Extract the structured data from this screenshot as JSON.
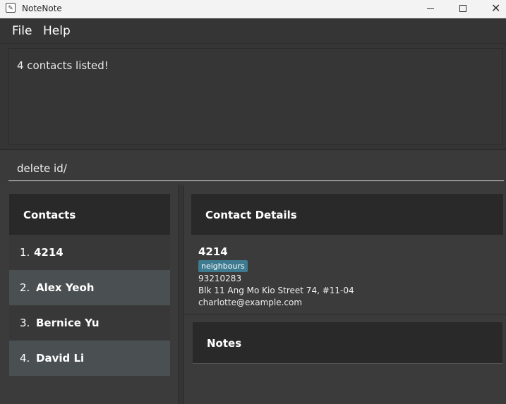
{
  "window": {
    "title": "NoteNote",
    "icons": {
      "app": "notepad-icon",
      "minimize": "minimize-icon",
      "maximize": "maximize-icon",
      "close": "close-icon"
    }
  },
  "menu": {
    "items": [
      "File",
      "Help"
    ]
  },
  "result": {
    "message": "4 contacts listed!"
  },
  "command": {
    "value": "delete id/"
  },
  "contacts": {
    "header": "Contacts",
    "list": [
      {
        "index": "1.",
        "name": "4214"
      },
      {
        "index": "2.",
        "name": "Alex Yeoh"
      },
      {
        "index": "3.",
        "name": "Bernice Yu"
      },
      {
        "index": "4.",
        "name": "David Li"
      }
    ]
  },
  "details": {
    "header": "Contact Details",
    "name": "4214",
    "tag": "neighbours",
    "phone": "93210283",
    "address": "Blk 11 Ang Mo Kio Street 74, #11-04",
    "email": "charlotte@example.com"
  },
  "notes": {
    "header": "Notes"
  },
  "colors": {
    "background": "#3b3b3b",
    "header_bg": "#292929",
    "selected_row": "#4a5052",
    "tag_bg": "#3e7b91",
    "text": "#ffffff"
  }
}
